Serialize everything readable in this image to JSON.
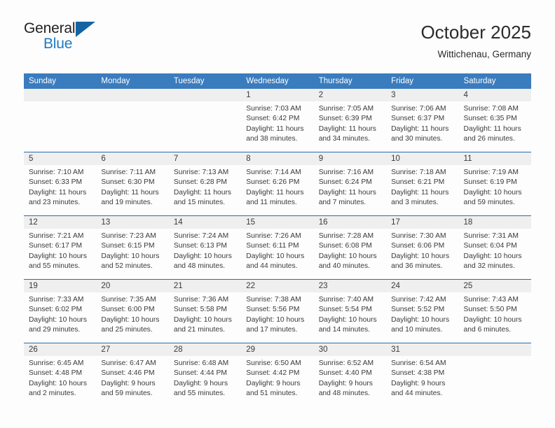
{
  "brand": {
    "name_top": "General",
    "name_bottom": "Blue",
    "triangle_color": "#1464a5",
    "blue_color": "#1f7ac4"
  },
  "header": {
    "title": "October 2025",
    "subtitle": "Wittichenau, Germany"
  },
  "theme": {
    "header_bg": "#3a7cbe",
    "daynum_bg": "#efefef",
    "row_border": "#2b6caf"
  },
  "weekdays": [
    "Sunday",
    "Monday",
    "Tuesday",
    "Wednesday",
    "Thursday",
    "Friday",
    "Saturday"
  ],
  "weeks": [
    [
      {
        "day": "",
        "lines": []
      },
      {
        "day": "",
        "lines": []
      },
      {
        "day": "",
        "lines": []
      },
      {
        "day": "1",
        "lines": [
          "Sunrise: 7:03 AM",
          "Sunset: 6:42 PM",
          "Daylight: 11 hours",
          "and 38 minutes."
        ]
      },
      {
        "day": "2",
        "lines": [
          "Sunrise: 7:05 AM",
          "Sunset: 6:39 PM",
          "Daylight: 11 hours",
          "and 34 minutes."
        ]
      },
      {
        "day": "3",
        "lines": [
          "Sunrise: 7:06 AM",
          "Sunset: 6:37 PM",
          "Daylight: 11 hours",
          "and 30 minutes."
        ]
      },
      {
        "day": "4",
        "lines": [
          "Sunrise: 7:08 AM",
          "Sunset: 6:35 PM",
          "Daylight: 11 hours",
          "and 26 minutes."
        ]
      }
    ],
    [
      {
        "day": "5",
        "lines": [
          "Sunrise: 7:10 AM",
          "Sunset: 6:33 PM",
          "Daylight: 11 hours",
          "and 23 minutes."
        ]
      },
      {
        "day": "6",
        "lines": [
          "Sunrise: 7:11 AM",
          "Sunset: 6:30 PM",
          "Daylight: 11 hours",
          "and 19 minutes."
        ]
      },
      {
        "day": "7",
        "lines": [
          "Sunrise: 7:13 AM",
          "Sunset: 6:28 PM",
          "Daylight: 11 hours",
          "and 15 minutes."
        ]
      },
      {
        "day": "8",
        "lines": [
          "Sunrise: 7:14 AM",
          "Sunset: 6:26 PM",
          "Daylight: 11 hours",
          "and 11 minutes."
        ]
      },
      {
        "day": "9",
        "lines": [
          "Sunrise: 7:16 AM",
          "Sunset: 6:24 PM",
          "Daylight: 11 hours",
          "and 7 minutes."
        ]
      },
      {
        "day": "10",
        "lines": [
          "Sunrise: 7:18 AM",
          "Sunset: 6:21 PM",
          "Daylight: 11 hours",
          "and 3 minutes."
        ]
      },
      {
        "day": "11",
        "lines": [
          "Sunrise: 7:19 AM",
          "Sunset: 6:19 PM",
          "Daylight: 10 hours",
          "and 59 minutes."
        ]
      }
    ],
    [
      {
        "day": "12",
        "lines": [
          "Sunrise: 7:21 AM",
          "Sunset: 6:17 PM",
          "Daylight: 10 hours",
          "and 55 minutes."
        ]
      },
      {
        "day": "13",
        "lines": [
          "Sunrise: 7:23 AM",
          "Sunset: 6:15 PM",
          "Daylight: 10 hours",
          "and 52 minutes."
        ]
      },
      {
        "day": "14",
        "lines": [
          "Sunrise: 7:24 AM",
          "Sunset: 6:13 PM",
          "Daylight: 10 hours",
          "and 48 minutes."
        ]
      },
      {
        "day": "15",
        "lines": [
          "Sunrise: 7:26 AM",
          "Sunset: 6:11 PM",
          "Daylight: 10 hours",
          "and 44 minutes."
        ]
      },
      {
        "day": "16",
        "lines": [
          "Sunrise: 7:28 AM",
          "Sunset: 6:08 PM",
          "Daylight: 10 hours",
          "and 40 minutes."
        ]
      },
      {
        "day": "17",
        "lines": [
          "Sunrise: 7:30 AM",
          "Sunset: 6:06 PM",
          "Daylight: 10 hours",
          "and 36 minutes."
        ]
      },
      {
        "day": "18",
        "lines": [
          "Sunrise: 7:31 AM",
          "Sunset: 6:04 PM",
          "Daylight: 10 hours",
          "and 32 minutes."
        ]
      }
    ],
    [
      {
        "day": "19",
        "lines": [
          "Sunrise: 7:33 AM",
          "Sunset: 6:02 PM",
          "Daylight: 10 hours",
          "and 29 minutes."
        ]
      },
      {
        "day": "20",
        "lines": [
          "Sunrise: 7:35 AM",
          "Sunset: 6:00 PM",
          "Daylight: 10 hours",
          "and 25 minutes."
        ]
      },
      {
        "day": "21",
        "lines": [
          "Sunrise: 7:36 AM",
          "Sunset: 5:58 PM",
          "Daylight: 10 hours",
          "and 21 minutes."
        ]
      },
      {
        "day": "22",
        "lines": [
          "Sunrise: 7:38 AM",
          "Sunset: 5:56 PM",
          "Daylight: 10 hours",
          "and 17 minutes."
        ]
      },
      {
        "day": "23",
        "lines": [
          "Sunrise: 7:40 AM",
          "Sunset: 5:54 PM",
          "Daylight: 10 hours",
          "and 14 minutes."
        ]
      },
      {
        "day": "24",
        "lines": [
          "Sunrise: 7:42 AM",
          "Sunset: 5:52 PM",
          "Daylight: 10 hours",
          "and 10 minutes."
        ]
      },
      {
        "day": "25",
        "lines": [
          "Sunrise: 7:43 AM",
          "Sunset: 5:50 PM",
          "Daylight: 10 hours",
          "and 6 minutes."
        ]
      }
    ],
    [
      {
        "day": "26",
        "lines": [
          "Sunrise: 6:45 AM",
          "Sunset: 4:48 PM",
          "Daylight: 10 hours",
          "and 2 minutes."
        ]
      },
      {
        "day": "27",
        "lines": [
          "Sunrise: 6:47 AM",
          "Sunset: 4:46 PM",
          "Daylight: 9 hours",
          "and 59 minutes."
        ]
      },
      {
        "day": "28",
        "lines": [
          "Sunrise: 6:48 AM",
          "Sunset: 4:44 PM",
          "Daylight: 9 hours",
          "and 55 minutes."
        ]
      },
      {
        "day": "29",
        "lines": [
          "Sunrise: 6:50 AM",
          "Sunset: 4:42 PM",
          "Daylight: 9 hours",
          "and 51 minutes."
        ]
      },
      {
        "day": "30",
        "lines": [
          "Sunrise: 6:52 AM",
          "Sunset: 4:40 PM",
          "Daylight: 9 hours",
          "and 48 minutes."
        ]
      },
      {
        "day": "31",
        "lines": [
          "Sunrise: 6:54 AM",
          "Sunset: 4:38 PM",
          "Daylight: 9 hours",
          "and 44 minutes."
        ]
      },
      {
        "day": "",
        "lines": []
      }
    ]
  ]
}
